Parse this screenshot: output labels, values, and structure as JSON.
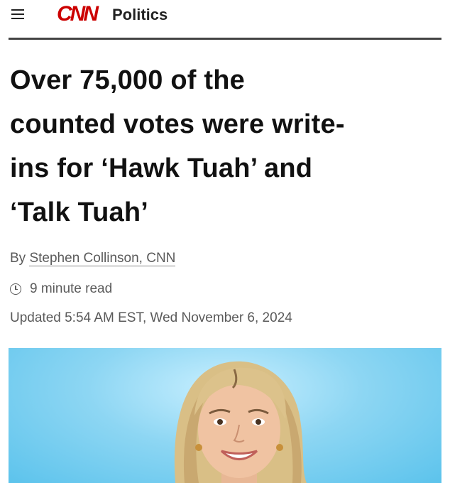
{
  "header": {
    "menu_icon": "hamburger-menu-icon",
    "logo_text": "CNN",
    "section": "Politics",
    "brand_color": "#cc0000"
  },
  "article": {
    "headline_lines": [
      "Over 75,000 of the",
      "counted votes were write-",
      "ins for ‘Hawk Tuah’ and",
      "‘Talk Tuah’"
    ],
    "byline_prefix": "By",
    "author": "Stephen Collinson, CNN",
    "read_time_icon": "clock-icon",
    "read_time": "9 minute read",
    "updated": "Updated 5:54 AM EST, Wed November 6, 2024"
  },
  "photo": {
    "background_color": "#8dd6f3"
  }
}
